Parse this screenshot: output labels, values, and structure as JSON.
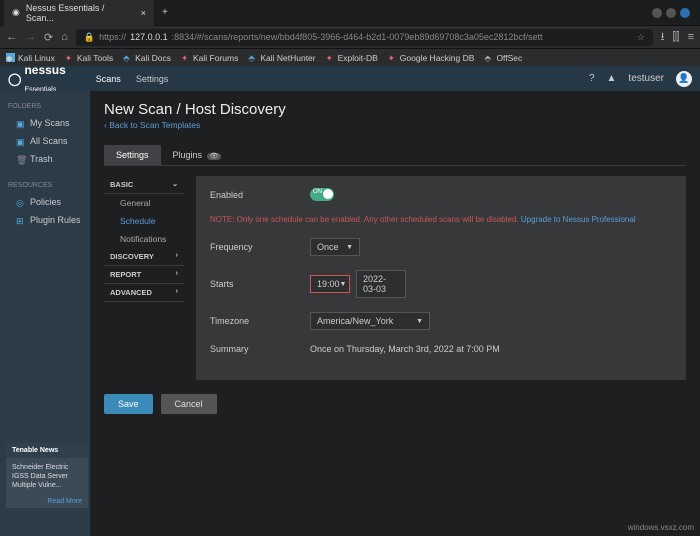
{
  "browser": {
    "tab_title": "Nessus Essentials / Scan...",
    "url_proto": "https://",
    "url_host": "127.0.0.1",
    "url_path": ":8834/#/scans/reports/new/bbd4f805-3966-d464-b2d1-0079eb89d69708c3a05ec2812bcf/sett",
    "bookmarks": [
      "Kali Linux",
      "Kali Tools",
      "Kali Docs",
      "Kali Forums",
      "Kali NetHunter",
      "Exploit-DB",
      "Google Hacking DB",
      "OffSec"
    ]
  },
  "header": {
    "logo": "nessus",
    "logo_sub": "Essentials",
    "nav": [
      "Scans",
      "Settings"
    ],
    "user": "testuser"
  },
  "sidebar": {
    "folders_label": "FOLDERS",
    "folders": [
      "My Scans",
      "All Scans",
      "Trash"
    ],
    "resources_label": "RESOURCES",
    "resources": [
      "Policies",
      "Plugin Rules"
    ]
  },
  "news": {
    "title": "Tenable News",
    "body": "Schneider Electric IGSS Data Server Multiple Vulne...",
    "link": "Read More"
  },
  "page": {
    "title": "New Scan / Host Discovery",
    "back": "Back to Scan Templates",
    "tabs": {
      "settings": "Settings",
      "plugins": "Plugins"
    },
    "nav": {
      "basic": "BASIC",
      "general": "General",
      "schedule": "Schedule",
      "notifications": "Notifications",
      "discovery": "DISCOVERY",
      "report": "REPORT",
      "advanced": "ADVANCED"
    },
    "form": {
      "enabled_label": "Enabled",
      "toggle_on": "ON",
      "note_red": "NOTE: Only one schedule can be enabled. Any other scheduled scans will be disabled.",
      "note_link": "Upgrade to Nessus Professional",
      "frequency_label": "Frequency",
      "frequency_value": "Once",
      "starts_label": "Starts",
      "starts_time": "19:00",
      "starts_date": "2022-03-03",
      "timezone_label": "Timezone",
      "timezone_value": "America/New_York",
      "summary_label": "Summary",
      "summary_value": "Once on Thursday, March 3rd, 2022 at 7:00 PM"
    },
    "buttons": {
      "save": "Save",
      "cancel": "Cancel"
    }
  },
  "watermark": "windows.vsxz.com"
}
